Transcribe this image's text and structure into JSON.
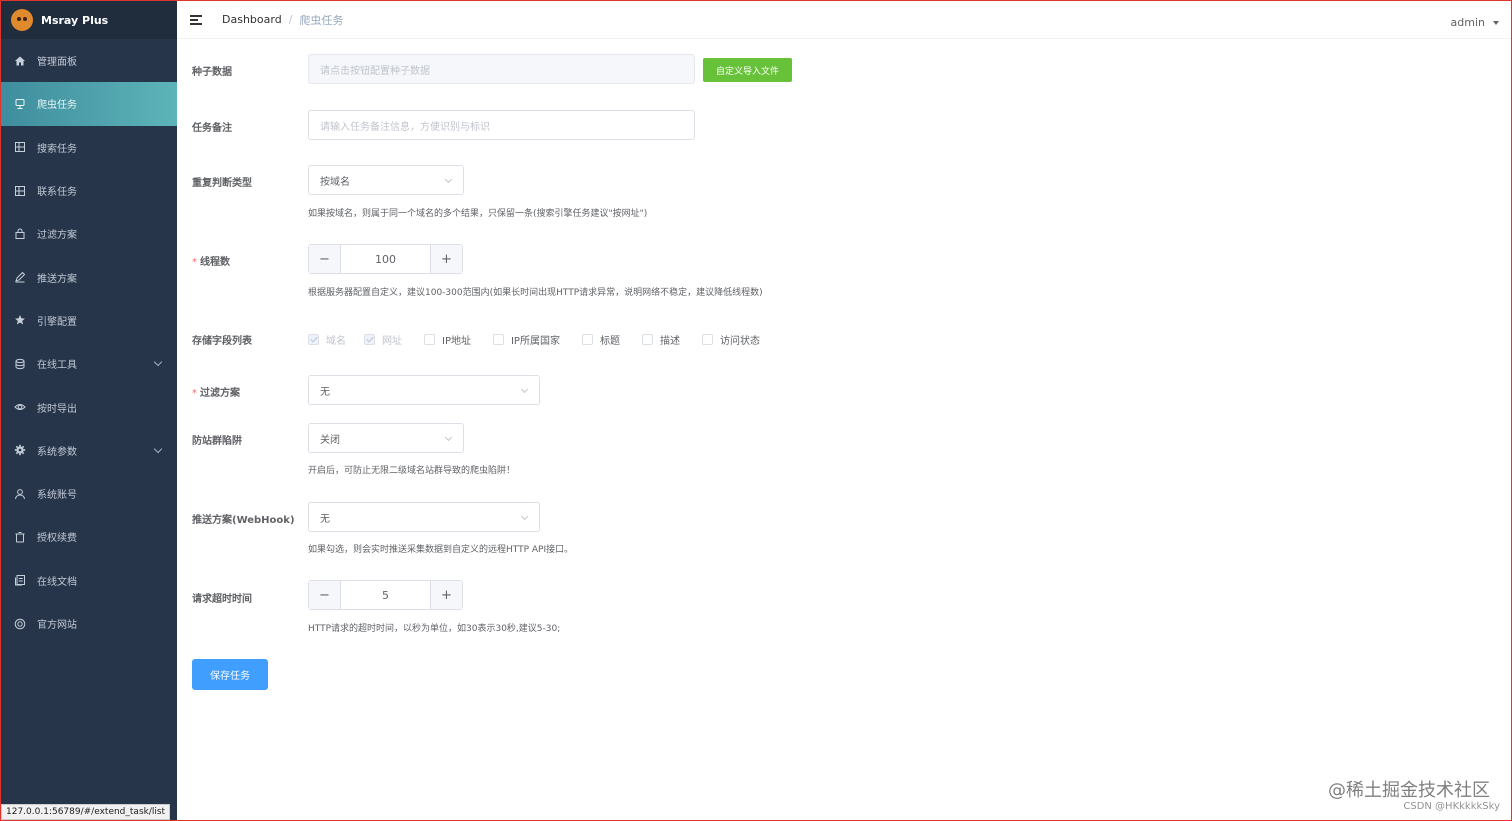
{
  "app": {
    "brand": "Msray Plus"
  },
  "sidebar": {
    "items": [
      {
        "label": "管理面板",
        "icon": "home-icon"
      },
      {
        "label": "爬虫任务",
        "icon": "spider-icon",
        "active": true
      },
      {
        "label": "搜索任务",
        "icon": "grid-icon"
      },
      {
        "label": "联系任务",
        "icon": "grid-icon"
      },
      {
        "label": "过滤方案",
        "icon": "filter-icon"
      },
      {
        "label": "推送方案",
        "icon": "edit-icon"
      },
      {
        "label": "引擎配置",
        "icon": "star-icon"
      },
      {
        "label": "在线工具",
        "icon": "tools-icon",
        "has_arrow": true
      },
      {
        "label": "按时导出",
        "icon": "eye-icon"
      },
      {
        "label": "系统参数",
        "icon": "gear-icon",
        "has_arrow": true
      },
      {
        "label": "系统账号",
        "icon": "user-icon"
      },
      {
        "label": "授权续费",
        "icon": "trash-icon"
      },
      {
        "label": "在线文档",
        "icon": "document-icon"
      },
      {
        "label": "官方网站",
        "icon": "globe-icon"
      }
    ]
  },
  "header": {
    "breadcrumb": {
      "home": "Dashboard",
      "separator": "/",
      "current": "爬虫任务"
    },
    "user": "admin"
  },
  "form": {
    "seed": {
      "label": "种子数据",
      "placeholder": "请点击按钮配置种子数据",
      "button": "自定义导入文件"
    },
    "note": {
      "label": "任务备注",
      "placeholder": "请输入任务备注信息，方便识别与标识"
    },
    "dedupe": {
      "label": "重复判断类型",
      "value": "按域名",
      "hint": "如果按域名，则属于同一个域名的多个结果，只保留一条(搜索引擎任务建议\"按网址\")"
    },
    "threads": {
      "label": "线程数",
      "required": "*",
      "value": "100",
      "minus": "−",
      "plus": "+",
      "hint": "根据服务器配置自定义，建议100-300范围内(如果长时间出现HTTP请求异常，说明网络不稳定，建议降低线程数)"
    },
    "fields": {
      "label": "存储字段列表",
      "options": [
        "域名",
        "网址",
        "IP地址",
        "IP所属国家",
        "标题",
        "描述",
        "访问状态"
      ]
    },
    "filter": {
      "label": "过滤方案",
      "required": "*",
      "value": "无"
    },
    "trap": {
      "label": "防站群陷阱",
      "value": "关闭",
      "hint": "开启后，可防止无限二级域名站群导致的爬虫陷阱！"
    },
    "webhook": {
      "label": "推送方案(WebHook)",
      "value": "无",
      "hint": "如果勾选，则会实时推送采集数据到自定义的远程HTTP API接口。"
    },
    "timeout": {
      "label": "请求超时时间",
      "value": "5",
      "minus": "−",
      "plus": "+",
      "hint": "HTTP请求的超时时间，以秒为单位，如30表示30秒,建议5-30;"
    },
    "save": "保存任务"
  },
  "statusbar": {
    "url": "127.0.0.1:56789/#/extend_task/list"
  },
  "watermark": {
    "main": "@稀土掘金技术社区",
    "sub": "CSDN @HKkkkkSky"
  }
}
